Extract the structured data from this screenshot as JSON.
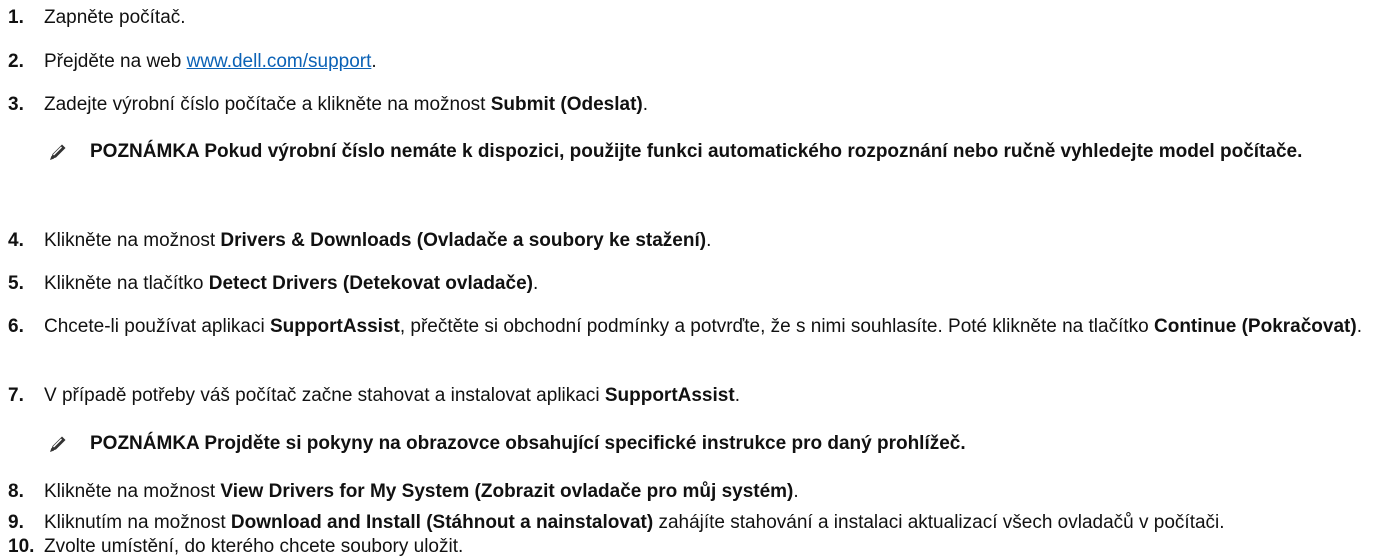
{
  "steps": [
    {
      "num": "1.",
      "parts": [
        {
          "t": "Zapněte počítač."
        }
      ]
    },
    {
      "num": "2.",
      "parts": [
        {
          "t": "Přejděte na web "
        },
        {
          "t": "www.dell.com/support",
          "link": true
        },
        {
          "t": "."
        }
      ]
    },
    {
      "num": "3.",
      "parts": [
        {
          "t": "Zadejte výrobní číslo počítače a klikněte na možnost "
        },
        {
          "t": "Submit (Odeslat)",
          "b": true
        },
        {
          "t": "."
        }
      ]
    },
    {
      "num": "4.",
      "parts": [
        {
          "t": "Klikněte na možnost "
        },
        {
          "t": "Drivers & Downloads (Ovladače a soubory ke stažení)",
          "b": true
        },
        {
          "t": "."
        }
      ]
    },
    {
      "num": "5.",
      "parts": [
        {
          "t": "Klikněte na tlačítko "
        },
        {
          "t": "Detect Drivers (Detekovat ovladače)",
          "b": true
        },
        {
          "t": "."
        }
      ]
    },
    {
      "num": "6.",
      "parts": [
        {
          "t": "Chcete-li používat aplikaci "
        },
        {
          "t": "SupportAssist",
          "b": true
        },
        {
          "t": ", přečtěte si obchodní podmínky a potvrďte, že s nimi souhlasíte. Poté klikněte na tlačítko "
        },
        {
          "t": "Continue (Pokračovat)",
          "b": true
        },
        {
          "t": "."
        }
      ]
    },
    {
      "num": "7.",
      "parts": [
        {
          "t": "V případě potřeby váš počítač začne stahovat a instalovat aplikaci "
        },
        {
          "t": "SupportAssist",
          "b": true
        },
        {
          "t": "."
        }
      ]
    },
    {
      "num": "8.",
      "parts": [
        {
          "t": "Klikněte na možnost "
        },
        {
          "t": "View Drivers for My System (Zobrazit ovladače pro můj systém)",
          "b": true
        },
        {
          "t": "."
        }
      ]
    },
    {
      "num": "9.",
      "parts": [
        {
          "t": "Kliknutím na možnost "
        },
        {
          "t": "Download and Install (Stáhnout a nainstalovat)",
          "b": true
        },
        {
          "t": " zahájíte stahování a instalaci aktualizací všech ovladačů v počítači."
        }
      ]
    },
    {
      "num": "10.",
      "parts": [
        {
          "t": "Zvolte umístění, do kterého chcete soubory uložit."
        }
      ]
    }
  ],
  "notes": [
    {
      "label": "POZNÁMKA",
      "text": "Pokud výrobní číslo nemáte k dispozici, použijte funkci automatického rozpoznání nebo ručně vyhledejte model počítače."
    },
    {
      "label": "POZNÁMKA",
      "text": "Projděte si pokyny na obrazovce obsahující specifické instrukce pro daný prohlížeč."
    }
  ],
  "icons": {
    "note": "note-pencil-icon"
  },
  "colors": {
    "link": "#0b62b6",
    "text": "#111111",
    "icon": "#333333"
  }
}
